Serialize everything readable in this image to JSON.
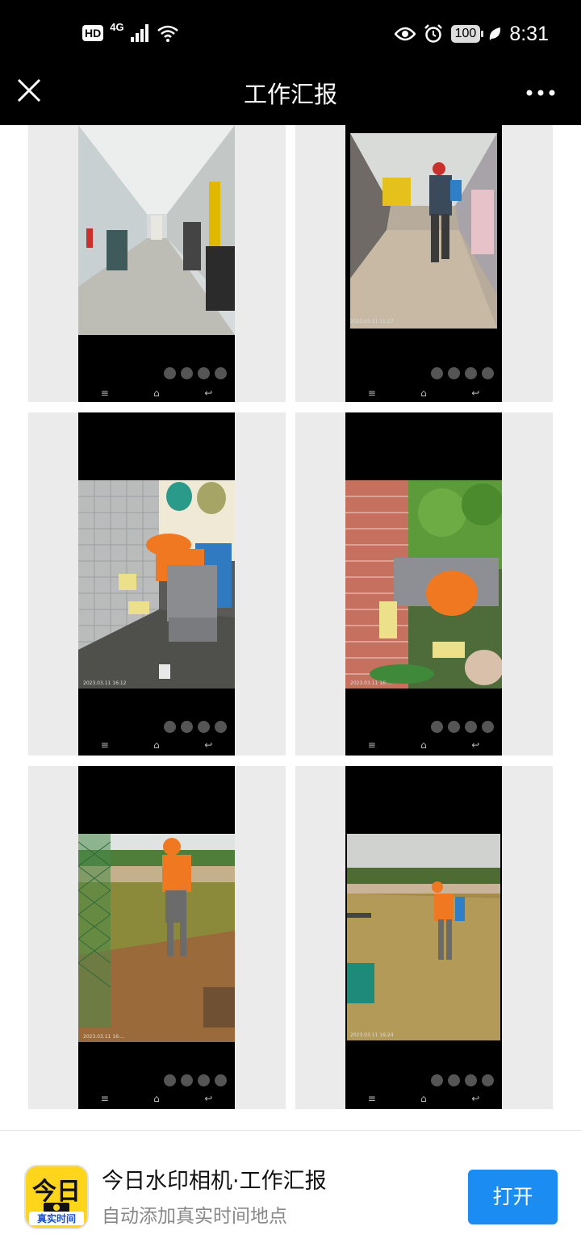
{
  "status_bar": {
    "hd_badge": "HD",
    "network": "4G",
    "battery": "100",
    "time": "8:31"
  },
  "nav": {
    "title": "工作汇报"
  },
  "screenshots": {
    "nav_keys": [
      "≡",
      "⌂",
      "↩"
    ],
    "photo_stamps": [
      "",
      "2023.03.11 11:27",
      "2023.03.11 16:12",
      "2023.03.11 16:...",
      "2023.03.11 16:...",
      "2023.03.11 16:24"
    ]
  },
  "footer": {
    "app_icon_top": "今日",
    "app_icon_bottom": "真实时间",
    "app_title": "今日水印相机·工作汇报",
    "app_subtitle": "自动添加真实时间地点",
    "open_label": "打开"
  },
  "colors": {
    "accent": "#1a8cf2",
    "app_icon_bg": "#fdd51a",
    "tile_bg": "#ebebeb"
  }
}
